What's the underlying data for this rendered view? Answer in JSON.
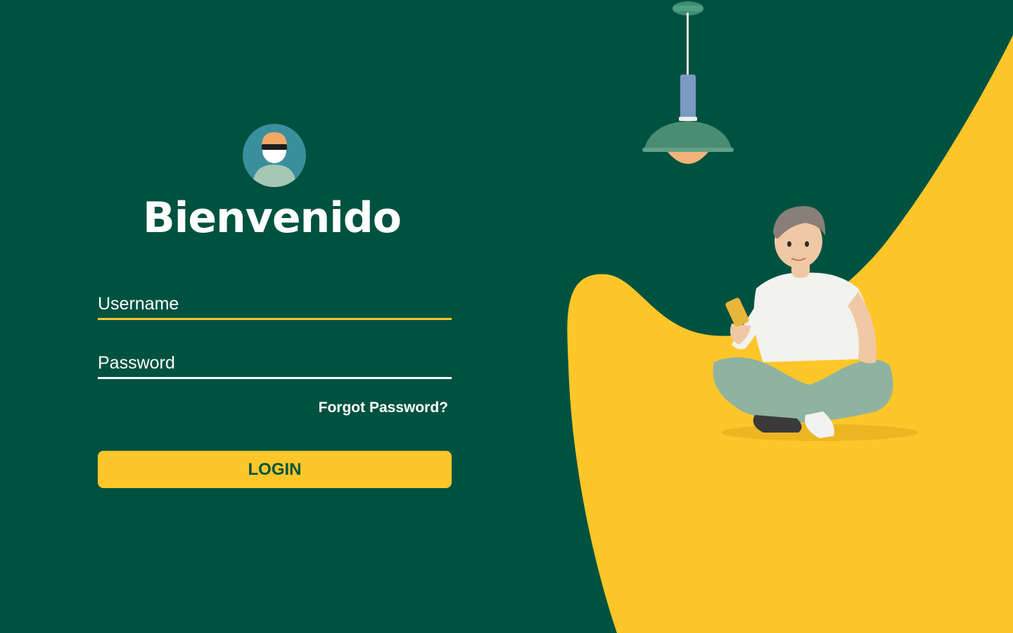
{
  "colors": {
    "background": "#005240",
    "accent": "#ffc629",
    "text": "#ffffff",
    "button_text": "#005240"
  },
  "header": {
    "avatar_icon": "user-avatar-icon",
    "title": "Bienvenido"
  },
  "form": {
    "username_placeholder": "Username",
    "username_value": "",
    "password_placeholder": "Password",
    "password_value": "",
    "forgot_label": "Forgot Password?",
    "login_label": "LOGIN"
  },
  "illustration": {
    "lamp_icon": "pendant-lamp-icon",
    "person_icon": "person-with-phone-illustration"
  }
}
